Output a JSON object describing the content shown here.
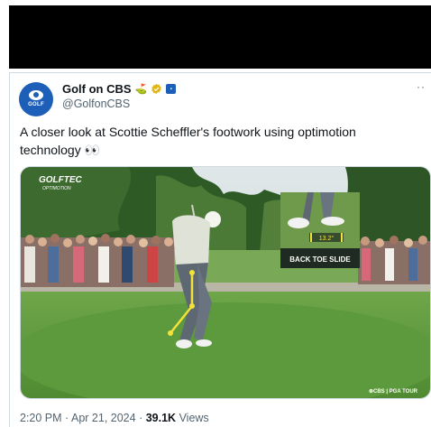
{
  "tweet": {
    "display_name": "Golf on CBS",
    "flag_emoji": "⛳",
    "handle": "@GolfonCBS",
    "avatar_text": "GOLF",
    "more_glyph": "··",
    "text": "A closer look at Scottie Scheffler's footwork using optimotion technology 👀",
    "time": "2:20 PM",
    "date": "Apr 21, 2024",
    "views_count": "39.1K",
    "views_label": "Views"
  },
  "media": {
    "brand_top": "GOLFTEC",
    "brand_sub": "OPTIMOTION",
    "angle": "13.2°",
    "inset_label": "BACK TOE SLIDE",
    "watermark": "⊕CBS | PGA TOUR"
  },
  "colors": {
    "brand_blue": "#1d5fb8",
    "verified_gold": "#e2b719",
    "overlay_yellow": "#f3e23a"
  }
}
